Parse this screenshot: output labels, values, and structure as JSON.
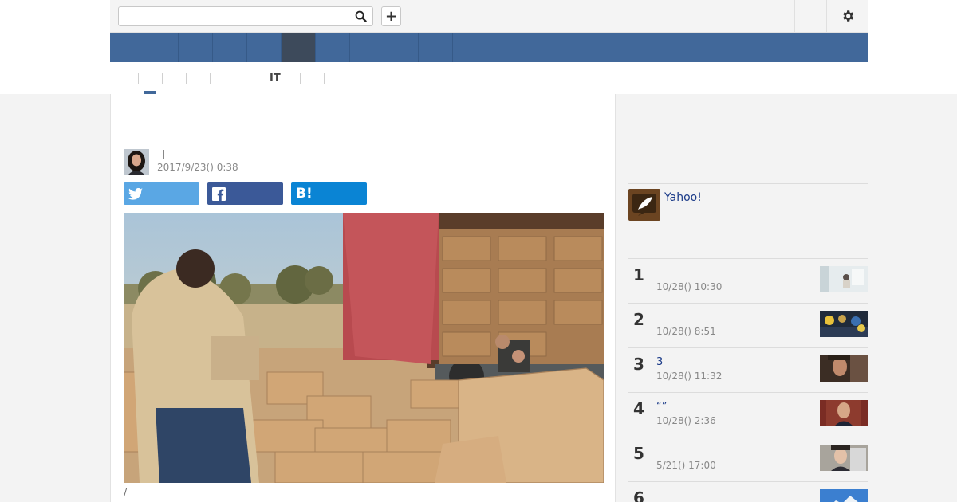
{
  "header": {
    "search": {
      "value": "",
      "placeholder": ""
    },
    "search_icon": "search-icon",
    "plus_label": "+",
    "settings_icon": "gear-icon"
  },
  "navbar": {
    "tab_count": 10,
    "active_index": 5
  },
  "subnav": {
    "items": [
      "",
      "",
      "",
      "",
      "",
      "IT",
      ""
    ],
    "active_index": 0
  },
  "article": {
    "title": "",
    "author": "",
    "date": "2017/9/23() 0:38",
    "share": {
      "twitter": "",
      "facebook": "",
      "hatena": "B!"
    },
    "caption": "/"
  },
  "sidebar": {
    "yahoo_label": "Yahoo!",
    "ranking": [
      {
        "rank": "1",
        "title": "",
        "time": "10/28() 10:30"
      },
      {
        "rank": "2",
        "title": "",
        "time": "10/28() 8:51"
      },
      {
        "rank": "3",
        "title": "3",
        "time": "10/28() 11:32"
      },
      {
        "rank": "4",
        "title": "“”",
        "time": "10/28() 2:36"
      },
      {
        "rank": "5",
        "title": "",
        "time": "5/21() 17:00"
      },
      {
        "rank": "6",
        "title": "",
        "time": ""
      }
    ]
  },
  "colors": {
    "nav_blue": "#41689a",
    "nav_active": "#3d4a5b",
    "twitter": "#5aa7e4",
    "facebook": "#3b5998",
    "hatena": "#0a84d4",
    "link": "#1a3a88"
  }
}
